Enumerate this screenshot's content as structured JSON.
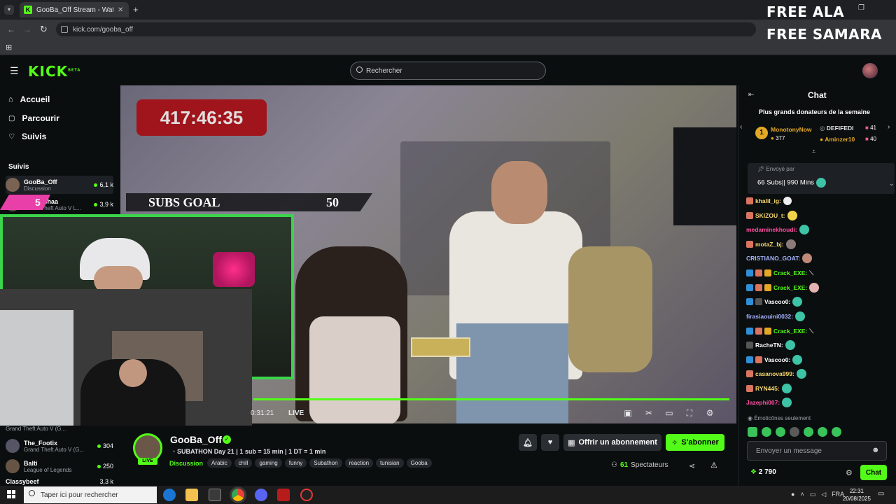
{
  "browser": {
    "tab_title": "GooBa_Off Stream - Watch Live",
    "url": "kick.com/gooba_off"
  },
  "overlay": {
    "line1": "FREE ALA",
    "line2": "FREE SAMARA"
  },
  "header": {
    "logo": "KICK",
    "logo_sup": "BETA",
    "search_placeholder": "Rechercher"
  },
  "sidebar": {
    "nav": [
      {
        "label": "Accueil",
        "icon": "home-icon"
      },
      {
        "label": "Parcourir",
        "icon": "browse-icon"
      },
      {
        "label": "Suivis",
        "icon": "heart-icon"
      }
    ],
    "section_title": "Suivis",
    "following": [
      {
        "name": "GooBa_Off",
        "category": "Discussion",
        "viewers": "6,1 k"
      },
      {
        "name": "a_chafchaa",
        "category": "Grand Theft Auto V L...",
        "viewers": "3,9 k"
      }
    ],
    "bottom_following": [
      {
        "name": "Grand Theft Auto V (G...",
        "category": "",
        "viewers": ""
      },
      {
        "name": "The_Footix",
        "category": "Grand Theft Auto V (G...",
        "viewers": "304"
      },
      {
        "name": "Balti",
        "category": "League of Legends",
        "viewers": "250"
      },
      {
        "name": "Classybeef",
        "category": "",
        "viewers": "3,3 k"
      }
    ]
  },
  "video": {
    "timer": "417:46:35",
    "subs_goal_label": "SUBS GOAL",
    "subs_goal_value": "50",
    "sub_alert_count": "5",
    "time_elapsed": "0:31:21",
    "live_label": "LIVE",
    "progress": 1.0
  },
  "stream": {
    "streamer": "GooBa_Off",
    "live_badge": "LIVE",
    "title": "SUBATHON Day 21 | 1 sub = 15 min | 1 DT = 1 min",
    "category": "Discussion",
    "tags": [
      "Arabic",
      "chill",
      "gaming",
      "funny",
      "Subathon",
      "reaction",
      "tunisian",
      "Gooba"
    ],
    "subscribe_gift_label": "Offrir un abonnement",
    "subscribe_label": "S'abonner",
    "viewers": "61",
    "viewers_label": "Spectateurs"
  },
  "chat": {
    "title": "Chat",
    "donors_title": "Plus grands donateurs de la semaine",
    "donors": [
      {
        "rank": "1",
        "name": "MonotonyNow",
        "value": "377"
      },
      {
        "rank": "",
        "name": "DEFIFEDI",
        "value": "41"
      },
      {
        "rank": "",
        "name": "Aminzer10",
        "value": "40"
      }
    ],
    "pinned_by": "Envoyé par",
    "pinned_message": "66 Subs|| 990 Mins",
    "messages": [
      {
        "user": "khalil_ig:",
        "color": "#f5d76e"
      },
      {
        "user": "SKIZOU_t:",
        "color": "#f5d76e"
      },
      {
        "user": "medaminekhoudi:",
        "color": "#ff4fa3"
      },
      {
        "user": "motaZ_bj:",
        "color": "#f5d76e"
      },
      {
        "user": "CRISTIANO_GOAT:",
        "color": "#a6b4ff"
      },
      {
        "user": "Crack_EXE:",
        "color": "#53fc18"
      },
      {
        "user": "Crack_EXE:",
        "color": "#53fc18"
      },
      {
        "user": "Vascoo0:",
        "color": "#ffffff"
      },
      {
        "user": "firasiaouini0032:",
        "color": "#a6b4ff"
      },
      {
        "user": "Crack_EXE:",
        "color": "#53fc18"
      },
      {
        "user": "RacheTN:",
        "color": "#ffffff"
      },
      {
        "user": "Vascoo0:",
        "color": "#ffffff"
      },
      {
        "user": "casanova999:",
        "color": "#f5d76e"
      },
      {
        "user": "RYN445:",
        "color": "#f5d76e"
      },
      {
        "user": "Jazephi007:",
        "color": "#ff4fa3"
      }
    ],
    "emotes_only": "Émoticônes seulement",
    "input_placeholder": "Envoyer un message",
    "points": "2 790",
    "chat_button": "Chat"
  },
  "taskbar": {
    "search_placeholder": "Taper ici pour rechercher",
    "lang": "FRA",
    "time": "22:31",
    "date": "20/08/2025"
  },
  "colors": {
    "kick_green": "#53fc18",
    "timer_red": "#a0141b",
    "cam_border": "#3ad54a"
  }
}
